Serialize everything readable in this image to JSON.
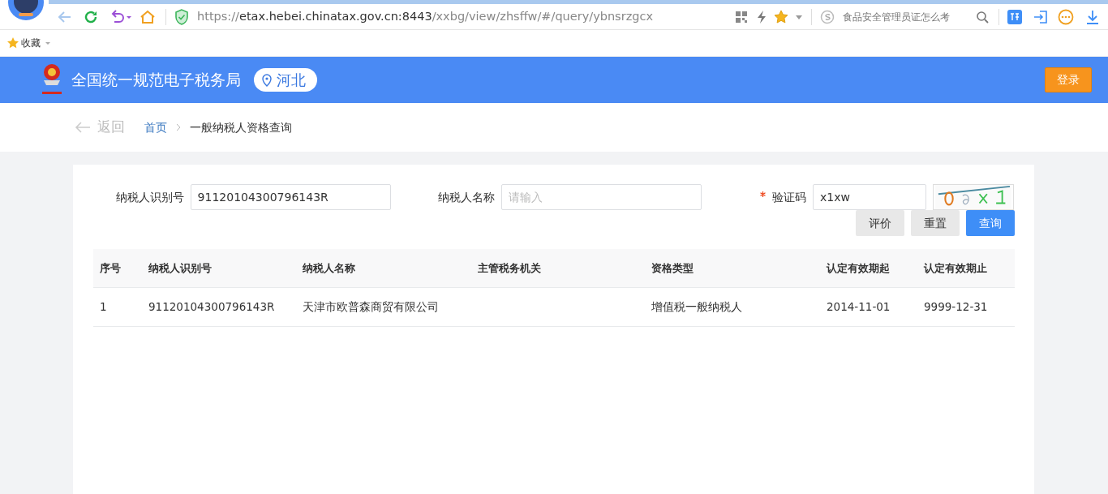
{
  "browser": {
    "address": {
      "scheme": "https://",
      "host": "etax.hebei.chinatax.gov.cn:8443",
      "path": "/xxbg/view/zhsffw/#/query/ybnsrzgcx"
    },
    "starred": true,
    "search_placeholder": "食品安全管理员证怎么考",
    "bookmarks": [
      {
        "label": "收藏"
      }
    ]
  },
  "header": {
    "title": "全国统一规范电子税务局",
    "region": "河北",
    "login": "登录"
  },
  "breadcrumb": {
    "back": "返回",
    "items": [
      {
        "label": "首页",
        "link": true
      },
      {
        "label": "一般纳税人资格查询",
        "link": false
      }
    ]
  },
  "form": {
    "fields": [
      {
        "label": "纳税人识别号",
        "value": "91120104300796143R",
        "required": false
      },
      {
        "label": "纳税人名称",
        "placeholder": "请输入",
        "required": false
      },
      {
        "label": "验证码",
        "value": "x1xw",
        "required": true
      }
    ],
    "buttons": [
      {
        "label": "评价",
        "kind": "secondary"
      },
      {
        "label": "重置",
        "kind": "secondary"
      },
      {
        "label": "查询",
        "kind": "primary"
      }
    ]
  },
  "table": {
    "columns": [
      "序号",
      "纳税人识别号",
      "纳税人名称",
      "主管税务机关",
      "资格类型",
      "认定有效期起",
      "认定有效期止"
    ],
    "rows": [
      [
        "1",
        "91120104300796143R",
        "天津市欧普森商贸有限公司",
        "",
        "增值税一般纳税人",
        "2014-11-01",
        "9999-12-31"
      ]
    ]
  }
}
